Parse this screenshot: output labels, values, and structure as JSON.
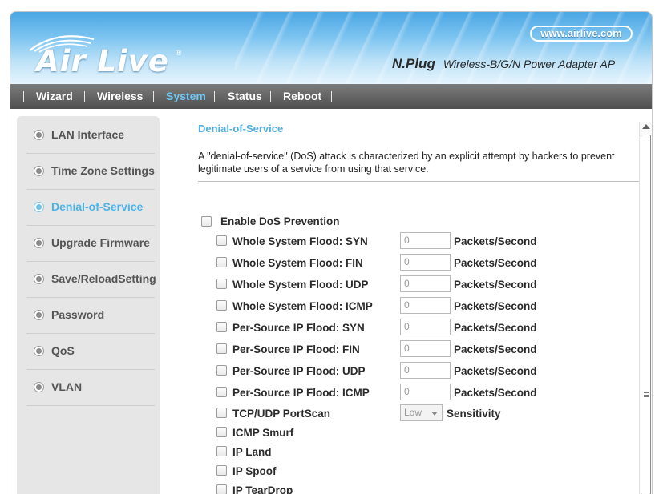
{
  "header": {
    "logo_text": "Air Live",
    "logo_reg": "®",
    "url": "www.airlive.com",
    "product_name": "N.Plug",
    "product_desc": "Wireless-B/G/N Power Adapter AP"
  },
  "nav": {
    "items": [
      {
        "label": "Wizard",
        "active": false
      },
      {
        "label": "Wireless",
        "active": false
      },
      {
        "label": "System",
        "active": true
      },
      {
        "label": "Status",
        "active": false
      },
      {
        "label": "Reboot",
        "active": false
      }
    ]
  },
  "sidebar": {
    "items": [
      {
        "label": "LAN Interface",
        "active": false
      },
      {
        "label": "Time Zone Settings",
        "active": false
      },
      {
        "label": "Denial-of-Service",
        "active": true
      },
      {
        "label": "Upgrade Firmware",
        "active": false
      },
      {
        "label": "Save/ReloadSetting",
        "active": false
      },
      {
        "label": "Password",
        "active": false
      },
      {
        "label": "QoS",
        "active": false
      },
      {
        "label": "VLAN",
        "active": false
      }
    ]
  },
  "main": {
    "title": "Denial-of-Service",
    "description": "A \"denial-of-service\" (DoS) attack is characterized by an explicit attempt by hackers to prevent legitimate users of a service from using that service.",
    "enable_label": "Enable DoS Prevention",
    "enable_checked": false,
    "unit_label": "Packets/Second",
    "flood_rows": [
      {
        "label": "Whole System Flood: SYN",
        "value": "0"
      },
      {
        "label": "Whole System Flood: FIN",
        "value": "0"
      },
      {
        "label": "Whole System Flood: UDP",
        "value": "0"
      },
      {
        "label": "Whole System Flood: ICMP",
        "value": "0"
      },
      {
        "label": "Per-Source IP Flood: SYN",
        "value": "0"
      },
      {
        "label": "Per-Source IP Flood: FIN",
        "value": "0"
      },
      {
        "label": "Per-Source IP Flood: UDP",
        "value": "0"
      },
      {
        "label": "Per-Source IP Flood: ICMP",
        "value": "0"
      }
    ],
    "portscan": {
      "label": "TCP/UDP PortScan",
      "selected": "Low",
      "unit": "Sensitivity"
    },
    "simple_rows": [
      {
        "label": "ICMP Smurf"
      },
      {
        "label": "IP Land"
      },
      {
        "label": "IP Spoof"
      },
      {
        "label": "IP TearDrop"
      }
    ]
  },
  "colors": {
    "accent": "#4bb3e8",
    "nav_bg": "#5e5e5e",
    "sidebar_bg": "#e6e6e6"
  }
}
